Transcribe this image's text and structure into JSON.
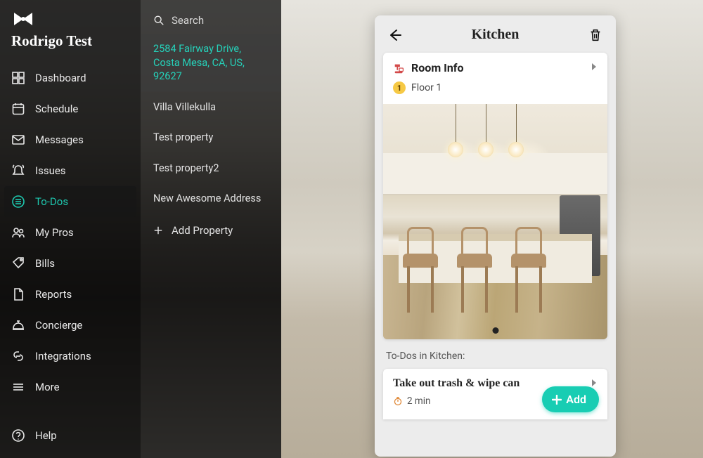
{
  "brand": "Rodrigo Test",
  "sidebar": {
    "items": [
      {
        "label": "Dashboard",
        "icon": "dashboard"
      },
      {
        "label": "Schedule",
        "icon": "calendar"
      },
      {
        "label": "Messages",
        "icon": "envelope"
      },
      {
        "label": "Issues",
        "icon": "bell"
      },
      {
        "label": "To-Dos",
        "icon": "list",
        "active": true
      },
      {
        "label": "My Pros",
        "icon": "people"
      },
      {
        "label": "Bills",
        "icon": "tag"
      },
      {
        "label": "Reports",
        "icon": "document"
      },
      {
        "label": "Concierge",
        "icon": "concierge"
      },
      {
        "label": "Integrations",
        "icon": "link"
      },
      {
        "label": "More",
        "icon": "menu"
      }
    ],
    "help_label": "Help"
  },
  "panel2": {
    "search_label": "Search",
    "properties": [
      {
        "label": "2584 Fairway Drive, Costa Mesa, CA, US, 92627",
        "active": true
      },
      {
        "label": "Villa Villekulla"
      },
      {
        "label": "Test property"
      },
      {
        "label": "Test property2"
      },
      {
        "label": "New Awesome Address"
      }
    ],
    "add_property_label": "Add Property"
  },
  "detail": {
    "title": "Kitchen",
    "room_info_label": "Room Info",
    "floor_label": "Floor 1",
    "floor_badge": "1",
    "todos_section": "To-Dos in Kitchen:",
    "todo": {
      "title": "Take out trash & wipe can",
      "duration": "2 min"
    },
    "add_label": "Add"
  }
}
